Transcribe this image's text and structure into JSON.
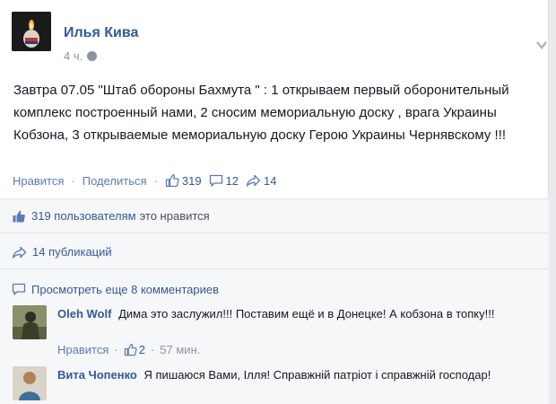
{
  "post": {
    "author": "Илья Кива",
    "time": "4 ч.",
    "text": "Завтра 07.05 \"Штаб обороны Бахмута \" : 1 открываем первый оборонительный комплекс построенный нами, 2 сносим мемориальную доску , врага Украины Кобзона, 3 открываемые мемориальную доску Герою Украины Чернявскому !!!",
    "actions": {
      "like_label": "Нравится",
      "separator": "·",
      "share_label": "Поделиться",
      "likes_count": "319",
      "comments_count": "12",
      "shares_count": "14"
    }
  },
  "feedback": {
    "likes_link": "319 пользователям",
    "likes_suffix": "это нравится",
    "shares_text": "14 публикаций",
    "view_more": "Просмотреть еще 8 комментариев"
  },
  "comments": [
    {
      "author": "Oleh Wolf",
      "text": "Дима это заслужил!!! Поставим ещё и в Донецке! А кобзона в топку!!!",
      "like_label": "Нравится",
      "separator": "·",
      "likes": "2",
      "time": "57 мин."
    },
    {
      "author": "Вита Чопенко",
      "text": "Я пишаюся Вами, Ілля! Справжній патріот і справжній господар!"
    }
  ],
  "colors": {
    "link_blue": "#365899",
    "muted_grey": "#90949c",
    "background": "#e9ebee"
  }
}
